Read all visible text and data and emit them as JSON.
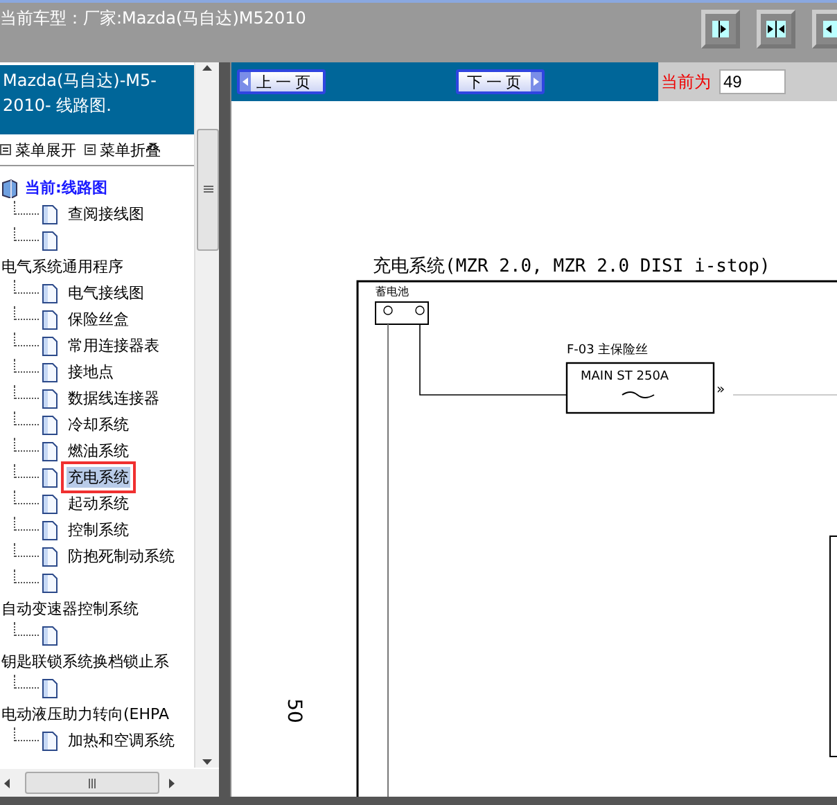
{
  "header": {
    "title": "当前车型：厂家:Mazda(马自达)M52010"
  },
  "sidebar": {
    "title": "Mazda(马自达)-M5-2010- 线路图.",
    "actions": [
      "菜单展开",
      "菜单折叠"
    ],
    "tree": [
      {
        "label": "当前:线路图",
        "kind": "root",
        "selected": false,
        "children": [
          {
            "label": "查阅接线图",
            "kind": "page",
            "selected": false
          },
          {
            "kind": "page",
            "selected": false
          }
        ]
      },
      {
        "label": "电气系统通用程序",
        "kind": "group",
        "selected": false,
        "children": [
          {
            "label": "电气接线图",
            "kind": "page",
            "selected": false
          },
          {
            "label": "保险丝盒",
            "kind": "page",
            "selected": false
          },
          {
            "label": "常用连接器表",
            "kind": "page",
            "selected": false
          },
          {
            "label": "接地点",
            "kind": "page",
            "selected": false
          },
          {
            "label": "数据线连接器",
            "kind": "page",
            "selected": false
          },
          {
            "label": "冷却系统",
            "kind": "page",
            "selected": false
          },
          {
            "label": "燃油系统",
            "kind": "page",
            "selected": false
          },
          {
            "label": "充电系统",
            "kind": "page",
            "selected": true
          },
          {
            "label": "起动系统",
            "kind": "page",
            "selected": false
          },
          {
            "label": "控制系统",
            "kind": "page",
            "selected": false
          },
          {
            "label": "防抱死制动系统",
            "kind": "page",
            "selected": false
          },
          {
            "kind": "page",
            "selected": false
          }
        ]
      },
      {
        "label": "自动变速器控制系统",
        "kind": "group",
        "selected": false,
        "children": [
          {
            "kind": "page",
            "selected": false
          }
        ]
      },
      {
        "label": "钥匙联锁系统换档锁止系",
        "kind": "group",
        "selected": false,
        "children": [
          {
            "kind": "page",
            "selected": false
          }
        ]
      },
      {
        "label": "电动液压助力转向(EHPA",
        "kind": "group",
        "selected": false,
        "children": [
          {
            "label": "加热和空调系统",
            "kind": "page",
            "selected": false
          }
        ]
      }
    ]
  },
  "toolbar": {
    "prev": "上一页",
    "next": "下一页",
    "page_label": "当前为",
    "page_value": "49"
  },
  "document": {
    "title": "充电系统(MZR 2.0, MZR 2.0 DISI i-stop)",
    "battery_label": "蓄电池",
    "fuse_label": "F-03 主保险丝",
    "fuse_text": "MAIN ST 250A",
    "connector_mark": "»",
    "page_number": "50"
  }
}
